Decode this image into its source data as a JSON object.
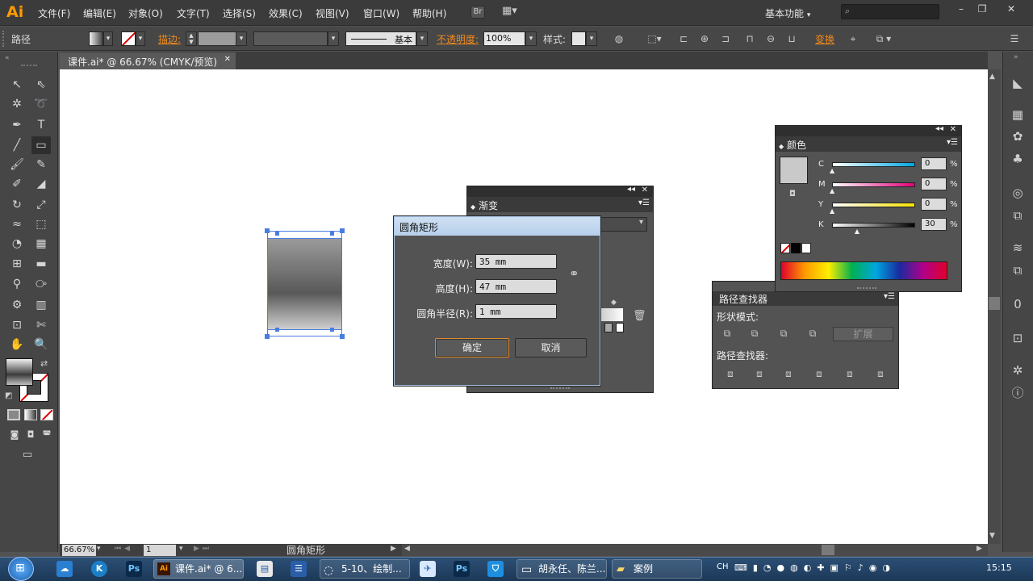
{
  "app": {
    "logo": "Ai"
  },
  "menu": [
    "文件(F)",
    "编辑(E)",
    "对象(O)",
    "文字(T)",
    "选择(S)",
    "效果(C)",
    "视图(V)",
    "窗口(W)",
    "帮助(H)"
  ],
  "bridge_btn": "Br",
  "workspace": "基本功能",
  "control": {
    "selection_label": "路径",
    "stroke_label": "描边:",
    "stroke_style": "基本",
    "opacity_label": "不透明度:",
    "opacity_value": "100%",
    "style_label": "样式:",
    "transform_label": "变换"
  },
  "doc_tab": {
    "title": "课件.ai* @ 66.67% (CMYK/预览)"
  },
  "gradient_panel": {
    "title": "渐变"
  },
  "color_panel": {
    "title": "颜色",
    "channels": [
      {
        "name": "C",
        "value": "0",
        "unit": "%"
      },
      {
        "name": "M",
        "value": "0",
        "unit": "%"
      },
      {
        "name": "Y",
        "value": "0",
        "unit": "%"
      },
      {
        "name": "K",
        "value": "30",
        "unit": "%"
      }
    ],
    "swatch": "#c9c9c9"
  },
  "pathfinder": {
    "title": "路径查找器",
    "shape_modes": "形状模式:",
    "expand": "扩展",
    "pathfinders": "路径查找器:"
  },
  "dialog": {
    "title": "圆角矩形",
    "width_label": "宽度(W):",
    "width_value": "35 mm",
    "height_label": "高度(H):",
    "height_value": "47 mm",
    "radius_label": "圆角半径(R):",
    "radius_value": "1 mm",
    "ok": "确定",
    "cancel": "取消"
  },
  "status": {
    "zoom": "66.67%",
    "artboard": "1",
    "tool": "圆角矩形"
  },
  "taskbar": {
    "tasks": [
      "课件.ai* @ 6...",
      "5-10、绘制...",
      "胡永任、陈兰...",
      "案例"
    ],
    "lang": "CH",
    "clock": "15:15"
  }
}
